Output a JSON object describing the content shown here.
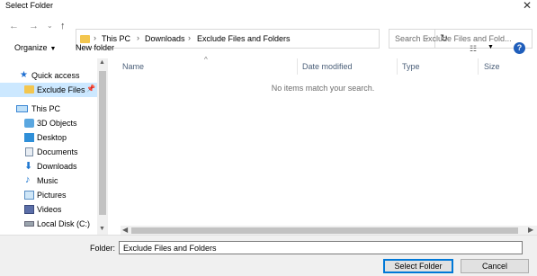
{
  "window": {
    "title": "Select Folder",
    "close_icon": "close-icon"
  },
  "nav": {
    "back_icon": "back-arrow-icon",
    "forward_icon": "forward-arrow-icon",
    "recent_icon": "chevron-down-icon",
    "up_icon": "up-arrow-icon",
    "breadcrumb": [
      "This PC",
      "Downloads",
      "Exclude Files and Folders"
    ],
    "refresh_icon": "refresh-icon"
  },
  "search": {
    "placeholder": "Search Exclude Files and Fold..."
  },
  "toolbar": {
    "organize_label": "Organize",
    "new_folder_label": "New folder",
    "help_label": "?"
  },
  "sidebar": {
    "items": [
      {
        "label": "Quick access",
        "icon": "star-icon"
      },
      {
        "label": "Exclude Files",
        "icon": "folder-icon",
        "selected": true
      },
      {
        "label": "This PC",
        "icon": "computer-icon"
      },
      {
        "label": "3D Objects",
        "icon": "cube-icon"
      },
      {
        "label": "Desktop",
        "icon": "desktop-icon"
      },
      {
        "label": "Documents",
        "icon": "documents-icon"
      },
      {
        "label": "Downloads",
        "icon": "download-icon"
      },
      {
        "label": "Music",
        "icon": "music-icon"
      },
      {
        "label": "Pictures",
        "icon": "pictures-icon"
      },
      {
        "label": "Videos",
        "icon": "videos-icon"
      },
      {
        "label": "Local Disk (C:)",
        "icon": "disk-icon"
      }
    ]
  },
  "list": {
    "columns": [
      "Name",
      "Date modified",
      "Type",
      "Size"
    ],
    "empty_message": "No items match your search."
  },
  "footer": {
    "folder_label": "Folder:",
    "folder_value": "Exclude Files and Folders",
    "select_label": "Select Folder",
    "cancel_label": "Cancel"
  },
  "colors": {
    "accent": "#0078d7",
    "selection": "#cce8ff",
    "folder": "#f3c64f",
    "help": "#1f5ebb"
  }
}
